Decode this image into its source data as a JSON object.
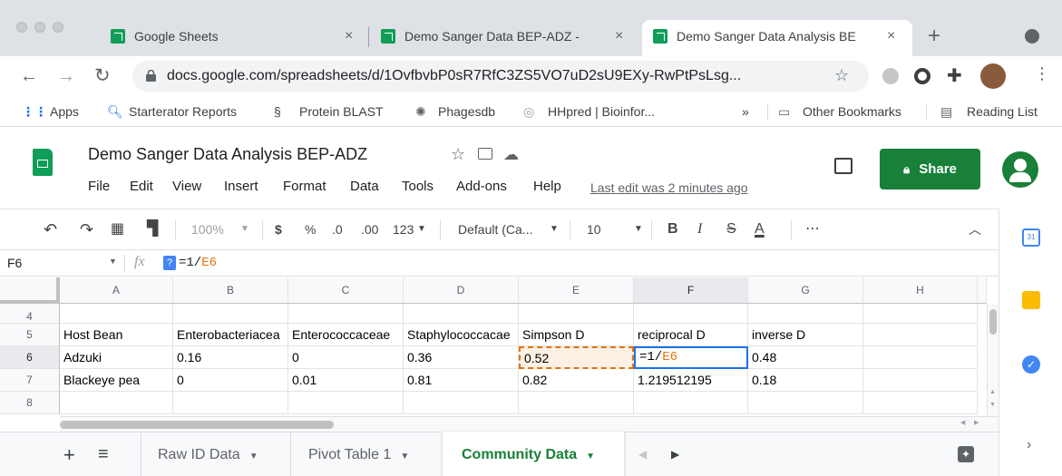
{
  "browser": {
    "tabs": [
      {
        "title": "Google Sheets",
        "active": false
      },
      {
        "title": "Demo Sanger Data BEP-ADZ -",
        "active": false
      },
      {
        "title": "Demo Sanger Data Analysis BE",
        "active": true
      }
    ],
    "new_tab": "+",
    "tab_close": "×",
    "url": "docs.google.com/spreadsheets/d/1OvfbvbP0sR7RfC3ZS5VO7uD2sU9EXy-RwPtPsLsg...",
    "bookmarks": [
      "Apps",
      "Starterator Reports",
      "Protein BLAST",
      "Phagesdb",
      "HHpred | Bioinfor..."
    ],
    "bookmarks_overflow": "»",
    "other_bookmarks": "Other Bookmarks",
    "reading_list": "Reading List"
  },
  "sheets": {
    "doc_title": "Demo Sanger Data Analysis BEP-ADZ",
    "menus": [
      "File",
      "Edit",
      "View",
      "Insert",
      "Format",
      "Data",
      "Tools",
      "Add-ons",
      "Help"
    ],
    "last_edit": "Last edit was 2 minutes ago",
    "share_label": "Share",
    "toolbar": {
      "zoom": "100%",
      "currency": "$",
      "percent": "%",
      "dec_decrease": ".0",
      "dec_increase": ".00",
      "more_formats": "123",
      "font": "Default (Ca...",
      "font_size": "10",
      "bold": "B",
      "italic": "I",
      "strike": "S",
      "text_color": "A",
      "more": "⋯"
    },
    "name_box": "F6",
    "fx": "fx",
    "help_badge": "?",
    "formula_prefix": "=1/",
    "formula_ref": "E6",
    "columns": [
      "A",
      "B",
      "C",
      "D",
      "E",
      "F",
      "G",
      "H"
    ],
    "rows": [
      {
        "num": "4",
        "cells": [
          "",
          "",
          "",
          "",
          "",
          "",
          "",
          ""
        ]
      },
      {
        "num": "5",
        "cells": [
          "Host Bean",
          "Enterobacteriacea",
          "Enterococcaceae",
          "Staphylococcacae",
          "Simpson D",
          "reciprocal D",
          "inverse D",
          ""
        ]
      },
      {
        "num": "6",
        "cells": [
          "Adzuki",
          "0.16",
          "0",
          "0.36",
          "0.52",
          "",
          "0.48",
          ""
        ]
      },
      {
        "num": "7",
        "cells": [
          "Blackeye pea",
          "0",
          "0.01",
          "0.81",
          "0.82",
          "1.219512195",
          "0.18",
          ""
        ]
      },
      {
        "num": "8",
        "cells": [
          "",
          "",
          "",
          "",
          "",
          "",
          "",
          ""
        ]
      }
    ],
    "editing_cell": {
      "prefix": "=1/",
      "ref": "E6"
    },
    "sheet_tabs": [
      "Raw ID Data",
      "Pivot Table 1",
      "Community Data"
    ],
    "active_sheet": "Community Data",
    "add_sheet": "+",
    "sheet_list": "≡",
    "accent_green": "#188038",
    "ref_orange": "#e8710a",
    "select_blue": "#1a73e8"
  }
}
